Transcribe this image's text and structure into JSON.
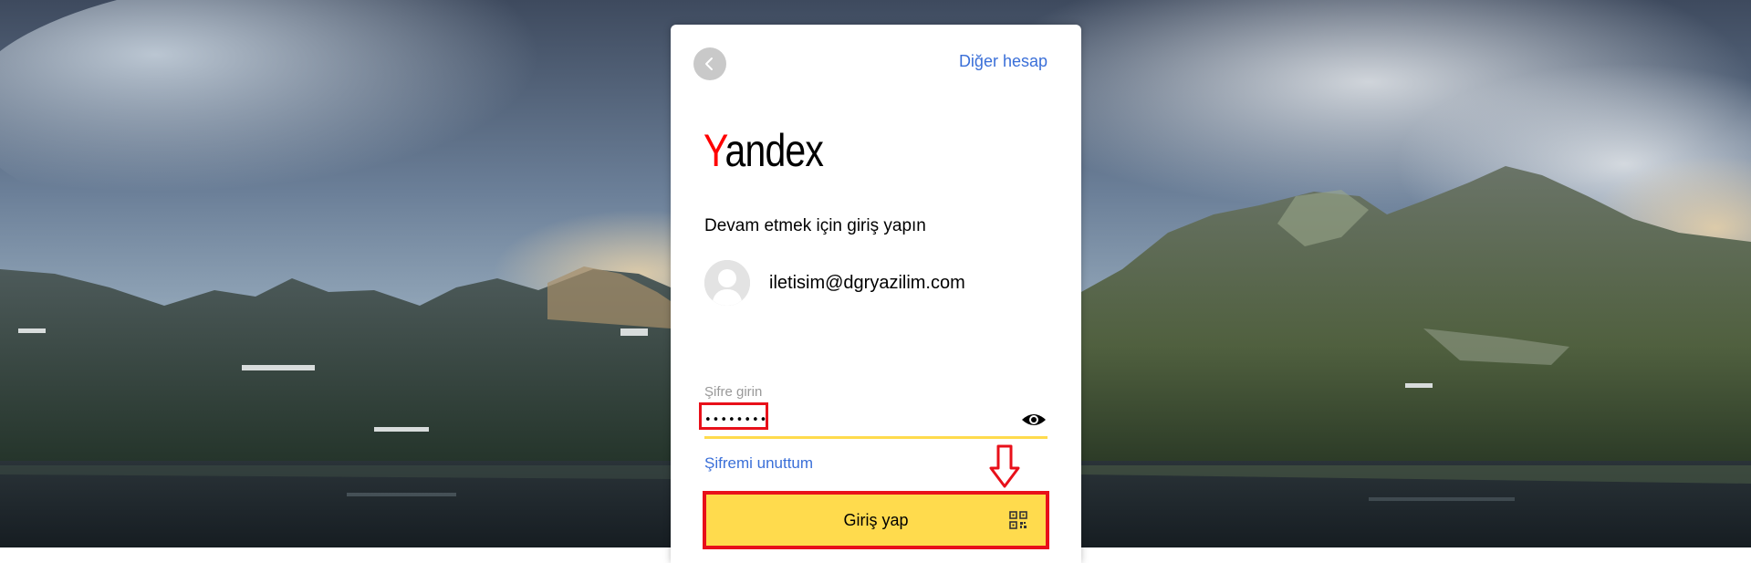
{
  "header": {
    "back_icon": "chevron-left-icon",
    "other_account_label": "Diğer hesap"
  },
  "brand": {
    "logo_first_letter": "Y",
    "logo_rest": "andex",
    "logo_first_letter_color": "#ff0000"
  },
  "form": {
    "subtitle": "Devam etmek için giriş yapın",
    "account_email": "iletisim@dgryazilim.com",
    "password_label": "Şifre girin",
    "password_value": "••••••••",
    "forgot_password_label": "Şifremi unuttum",
    "submit_label": "Giriş yap",
    "show_password_icon": "eye-icon",
    "qr_icon": "qr-code-icon"
  },
  "colors": {
    "accent_yellow": "#ffdb4d",
    "link_blue": "#3a6fd8",
    "annotation_red": "#e8101a"
  }
}
